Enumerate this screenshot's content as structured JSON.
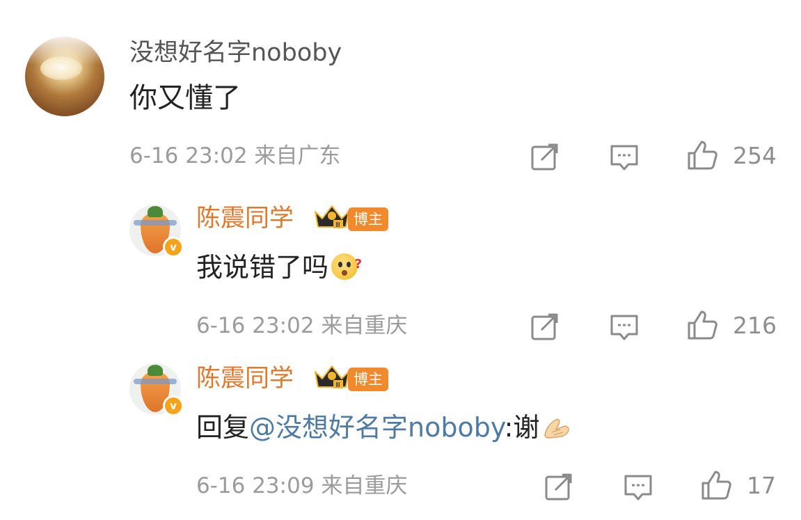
{
  "comment": {
    "username": "没想好名字noboby",
    "text": "你又懂了",
    "meta": "6-16 23:02 来自广东",
    "likes": "254",
    "avatar_icon": "cream-puff-avatar"
  },
  "replies": [
    {
      "username": "陈震同学",
      "badge": "博主",
      "text": "我说错了吗",
      "emoji": "confused-face-emoji",
      "meta": "6-16 23:02 来自重庆",
      "likes": "216"
    },
    {
      "username": "陈震同学",
      "badge": "博主",
      "text_prefix": "回复",
      "mention": "@没想好名字noboby",
      "text_suffix": ":谢",
      "emoji": "pray-hands-emoji",
      "meta": "6-16 23:09 来自重庆",
      "likes": "17"
    }
  ],
  "icons": {
    "share": "share-icon",
    "comment": "comment-icon",
    "like": "thumbs-up-icon",
    "crown": "crown-level-icon",
    "verified": "verified-v-icon"
  },
  "colors": {
    "mention": "#4f7aa3",
    "blogger_name": "#e0792e",
    "badge": "#f08a2c",
    "meta": "#9b9b9b"
  }
}
